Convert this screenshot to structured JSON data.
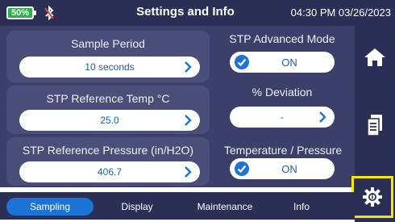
{
  "status": {
    "battery_percent": "50%",
    "title": "Settings and Info",
    "datetime": "04:30 PM 03/26/2023"
  },
  "fields": {
    "sample_period": {
      "label": "Sample Period",
      "value": "10 seconds"
    },
    "stp_ref_temp": {
      "label": "STP Reference Temp °C",
      "value": "25.0"
    },
    "stp_ref_pressure": {
      "label": "STP Reference Pressure (in/H2O)",
      "value": "406.7"
    },
    "stp_advanced_mode": {
      "label": "STP Advanced Mode",
      "value": "ON"
    },
    "deviation": {
      "label": "% Deviation",
      "value": "-"
    },
    "temp_pressure": {
      "label": "Temperature / Pressure",
      "value": "ON"
    }
  },
  "tabs": [
    "Sampling",
    "Display",
    "Maintenance",
    "Info"
  ],
  "active_tab": "Sampling",
  "rail": {
    "items": [
      "home-icon",
      "document-icon",
      "gear-icon"
    ],
    "highlight_color": "#f6e600"
  },
  "colors": {
    "accent": "#1b73d6",
    "bar": "#2b2f55",
    "panel": "#4a4e78",
    "battery": "#2bb34a"
  }
}
